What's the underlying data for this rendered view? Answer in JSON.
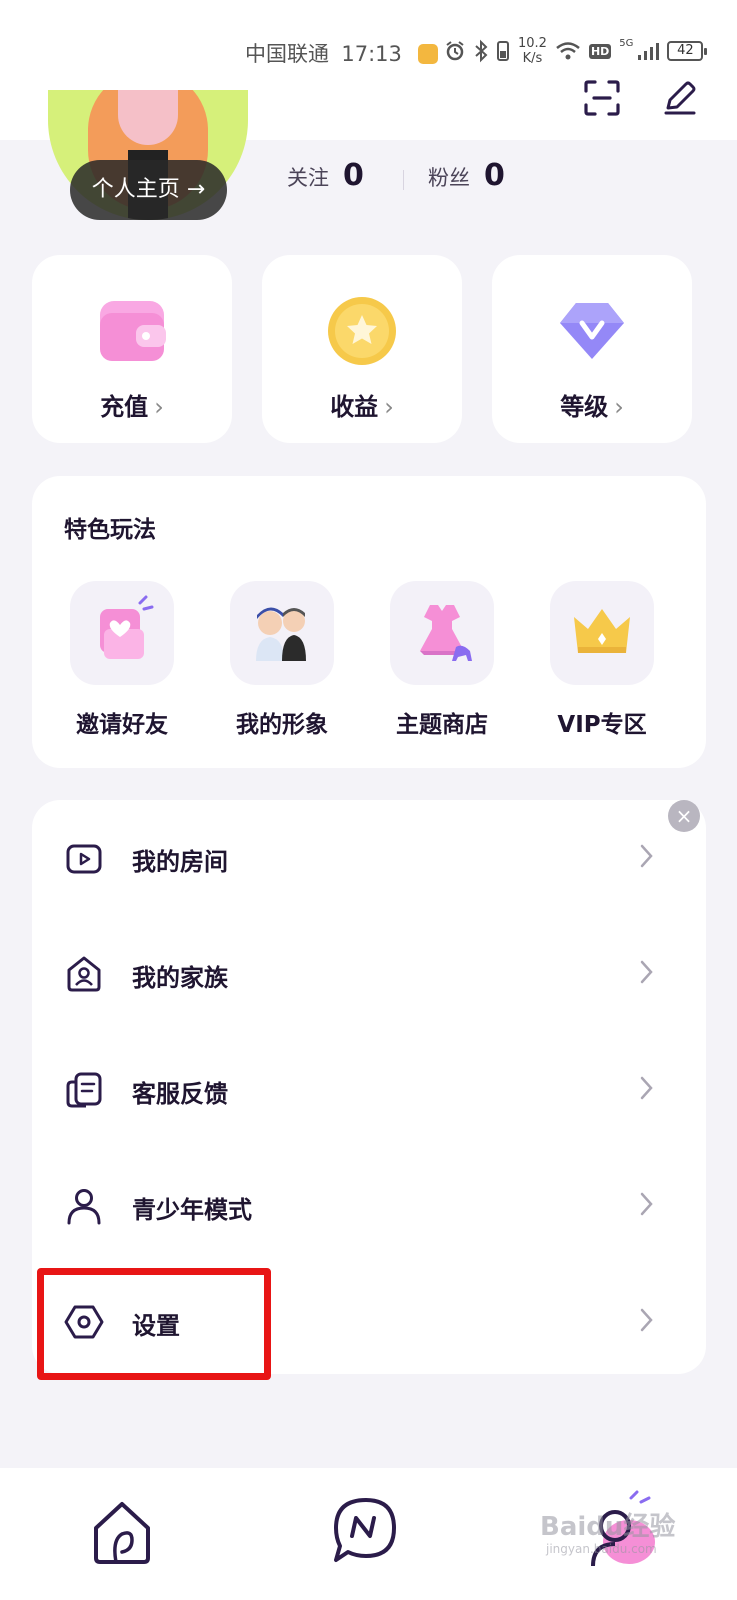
{
  "status_bar": {
    "carrier": "中国联通",
    "time": "17:13",
    "net_speed_value": "10.2",
    "net_speed_unit": "K/s",
    "hd": "HD",
    "network": "5G",
    "battery": "42"
  },
  "profile": {
    "home_button": "个人主页 →",
    "follow_label": "关注",
    "follow_count": "0",
    "fans_label": "粉丝",
    "fans_count": "0"
  },
  "quick_actions": [
    {
      "label": "充值",
      "icon": "wallet-icon",
      "color": "#f58fd6"
    },
    {
      "label": "收益",
      "icon": "coin-star-icon",
      "color": "#f6c94a"
    },
    {
      "label": "等级",
      "icon": "diamond-v-icon",
      "color": "#8a7cf5"
    }
  ],
  "features": {
    "title": "特色玩法",
    "items": [
      {
        "label": "邀请好友",
        "icon": "invite-heart-icon"
      },
      {
        "label": "我的形象",
        "icon": "avatar-figures-icon"
      },
      {
        "label": "主题商店",
        "icon": "dress-shop-icon"
      },
      {
        "label": "VIP专区",
        "icon": "crown-icon"
      }
    ]
  },
  "menu": {
    "close": "×",
    "items": [
      {
        "label": "我的房间",
        "icon": "room-play-icon"
      },
      {
        "label": "我的家族",
        "icon": "family-house-icon"
      },
      {
        "label": "客服反馈",
        "icon": "feedback-doc-icon"
      },
      {
        "label": "青少年模式",
        "icon": "person-icon"
      },
      {
        "label": "设置",
        "icon": "settings-hex-icon"
      }
    ]
  },
  "bottom_nav": {
    "items": [
      "home-icon",
      "chat-icon",
      "profile-icon"
    ],
    "watermark": "Baidu经验",
    "watermark_sub": "jingyan.baidu.com"
  },
  "accent": "#2b1c4a",
  "highlight_color": "#e81515"
}
